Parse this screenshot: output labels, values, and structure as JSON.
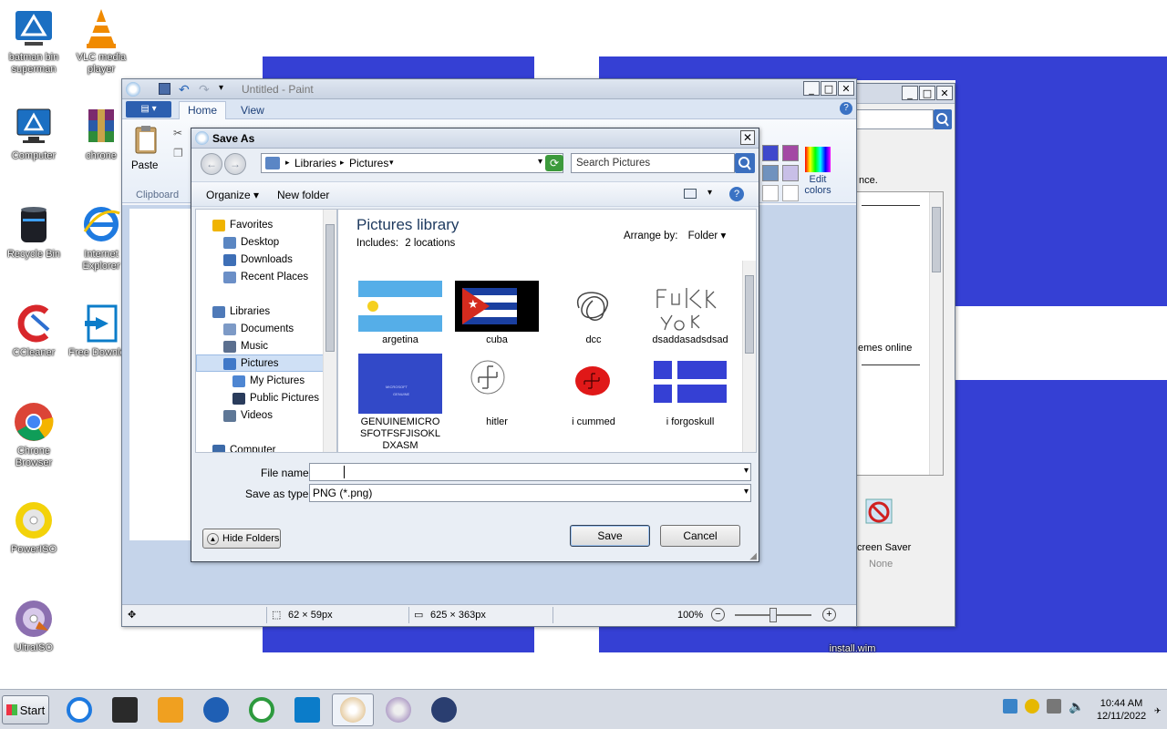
{
  "desktop": {
    "icons": [
      {
        "label": "batman bin superman"
      },
      {
        "label": "VLC media player"
      },
      {
        "label": "Computer"
      },
      {
        "label": "chrone"
      },
      {
        "label": "Recycle Bin"
      },
      {
        "label": "Internet Explorer"
      },
      {
        "label": "CCleaner"
      },
      {
        "label": "Free Downlo..."
      },
      {
        "label": "Chrone Browser"
      },
      {
        "label": "PowerISO"
      },
      {
        "label": "UltraISO"
      },
      {
        "label": "install.wim"
      }
    ]
  },
  "bg_window": {
    "text_fragment_1": "nce.",
    "text_fragment_2": "emes online",
    "screen_saver_label": "creen Saver",
    "screen_saver_value": "None"
  },
  "paint": {
    "title": "Untitled - Paint",
    "tabs": [
      "Home",
      "View"
    ],
    "paste_label": "Paste",
    "clipboard_group": "Clipboard",
    "edit_colors": "Edit colors",
    "status": {
      "selection_size": "62 × 59px",
      "image_size": "625 × 363px",
      "zoom": "100%"
    }
  },
  "saveas": {
    "title": "Save As",
    "breadcrumb": [
      "Libraries",
      "Pictures"
    ],
    "search_placeholder": "Search Pictures",
    "organize": "Organize",
    "new_folder": "New folder",
    "nav": {
      "favorites": "Favorites",
      "desktop": "Desktop",
      "downloads": "Downloads",
      "recent": "Recent Places",
      "libraries": "Libraries",
      "documents": "Documents",
      "music": "Music",
      "pictures": "Pictures",
      "my_pictures": "My Pictures",
      "public_pictures": "Public Pictures",
      "videos": "Videos",
      "computer": "Computer"
    },
    "library_title": "Pictures library",
    "includes_label": "Includes:",
    "includes_link": "2 locations",
    "arrange_by_label": "Arrange by:",
    "arrange_by_value": "Folder",
    "files": [
      {
        "name": "argetina"
      },
      {
        "name": "cuba"
      },
      {
        "name": "dcc"
      },
      {
        "name": "dsaddasadsdsad"
      },
      {
        "name": "GENUINEMICROSFOTFSFJISOKLDXASM",
        "thumb_text_1": "MICROSOFT",
        "thumb_text_2": "GENUINE"
      },
      {
        "name": "hitler"
      },
      {
        "name": "i cummed"
      },
      {
        "name": "i forgoskull"
      }
    ],
    "file_name_label": "File name:",
    "file_name_value": "",
    "save_type_label": "Save as type:",
    "save_type_value": "PNG (*.png)",
    "hide_folders": "Hide Folders",
    "save": "Save",
    "cancel": "Cancel"
  },
  "taskbar": {
    "start": "Start",
    "time": "10:44 AM",
    "date": "12/11/2022"
  },
  "colors": {
    "wallpaper": "#3540d4",
    "dialog_bg": "#e9eef5"
  }
}
